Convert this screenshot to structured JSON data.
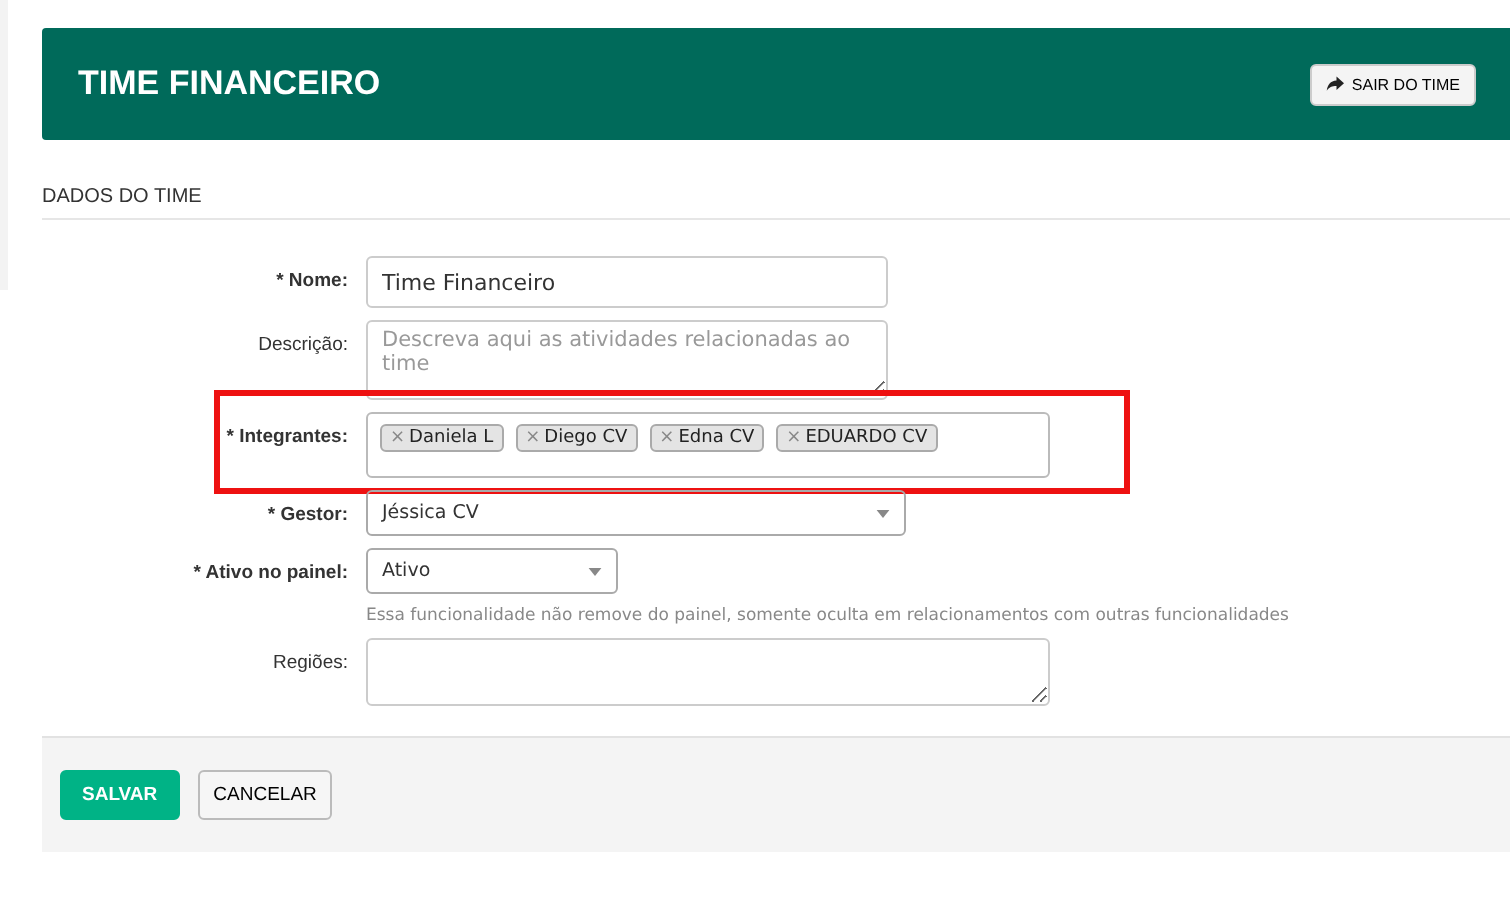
{
  "header": {
    "title": "TIME FINANCEIRO",
    "leave_button": "SAIR DO TIME"
  },
  "section_title": "DADOS DO TIME",
  "fields": [
    {
      "kind": "text",
      "label": "* Nome:",
      "value": "Time Financeiro"
    },
    {
      "kind": "textarea",
      "label": "Descrição:",
      "placeholder": "Descreva aqui as atividades relacionadas ao time"
    },
    {
      "kind": "tags",
      "label": "* Integrantes:",
      "tags": [
        {
          "remove": "×",
          "label": "Daniela L"
        },
        {
          "remove": "×",
          "label": "Diego CV"
        },
        {
          "remove": "×",
          "label": "Edna CV"
        },
        {
          "remove": "×",
          "label": "EDUARDO CV"
        }
      ],
      "highlighted": true
    },
    {
      "kind": "select",
      "label": "* Gestor:",
      "value": "Jéssica CV"
    },
    {
      "kind": "dropdown",
      "label": "* Ativo no painel:",
      "value": "Ativo",
      "hint": "Essa funcionalidade não remove do painel, somente oculta em relacionamentos com outras funcionalidades"
    },
    {
      "kind": "textarea",
      "label": "Regiões:"
    }
  ],
  "buttons": [
    {
      "label": "SALVAR",
      "primary": true
    },
    {
      "label": "CANCELAR",
      "primary": false
    }
  ]
}
